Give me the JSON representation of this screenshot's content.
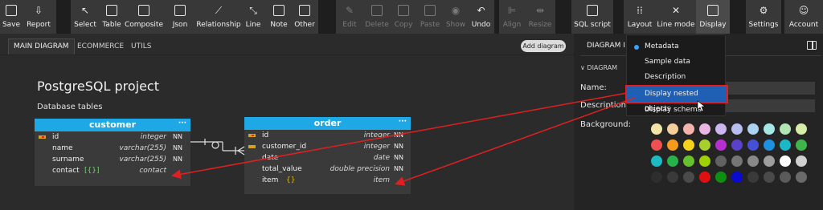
{
  "toolbar": {
    "save": "Save",
    "report": "Report",
    "select": "Select",
    "table": "Table",
    "composite": "Composite",
    "json": "Json",
    "relationship": "Relationship",
    "line": "Line",
    "note": "Note",
    "other": "Other",
    "edit": "Edit",
    "delete": "Delete",
    "copy": "Copy",
    "paste": "Paste",
    "show": "Show",
    "undo": "Undo",
    "align": "Align",
    "resize": "Resize",
    "sql_script": "SQL script",
    "layout": "Layout",
    "line_mode": "Line mode",
    "display": "Display",
    "settings": "Settings",
    "account": "Account"
  },
  "tabs": [
    "MAIN DIAGRAM",
    "ECOMMERCE",
    "UTILS"
  ],
  "add_diagram": "Add diagram",
  "diagram": {
    "title": "PostgreSQL project",
    "subtitle": "Database tables",
    "customer": {
      "name": "customer",
      "menu": "···",
      "rows": [
        {
          "name": "id",
          "type": "integer",
          "nn": "NN"
        },
        {
          "name": "name",
          "type": "varchar(255)",
          "nn": "NN"
        },
        {
          "name": "surname",
          "type": "varchar(255)",
          "nn": "NN"
        },
        {
          "name": "contact",
          "badge": "[{}]",
          "type": "contact",
          "nn": ""
        }
      ]
    },
    "order": {
      "name": "order",
      "menu": "···",
      "rows": [
        {
          "name": "id",
          "type": "integer",
          "nn": "NN"
        },
        {
          "name": "customer_id",
          "type": "integer",
          "nn": "NN"
        },
        {
          "name": "date",
          "type": "date",
          "nn": "NN"
        },
        {
          "name": "total_value",
          "type": "double precision",
          "nn": "NN"
        },
        {
          "name": "item",
          "badge": "{}",
          "type": "item",
          "nn": ""
        }
      ]
    }
  },
  "panel": {
    "tab": "DIAGRAM I",
    "section": "DIAGRAM",
    "name_label": "Name:",
    "description_label": "Description:",
    "background_label": "Background:"
  },
  "display_menu": {
    "items": [
      "Metadata",
      "Sample data",
      "Description",
      "Display nested objects",
      "Display schema"
    ],
    "checked": "Metadata",
    "highlighted": "Display nested objects"
  },
  "colors": {
    "accent": "#1ea8e6",
    "highlight": "#1f5fb4",
    "arrow": "#e02020",
    "swatches": [
      [
        "#f3e4a7",
        "#f4cf9a",
        "#f6b3ad",
        "#e9b5e3",
        "#cbb6ee",
        "#b7bdef",
        "#a9d3f0",
        "#a5e7e5",
        "#b3e4b3",
        "#d7eca7"
      ],
      [
        "#f05050",
        "#f49a1c",
        "#f4d21c",
        "#a8d02c",
        "#b62fcf",
        "#5a41c8",
        "#4550d6",
        "#1e90e0",
        "#1cb8c8",
        "#3fb54a"
      ],
      [
        "#1cbac2",
        "#27b24a",
        "#66c12e",
        "#9fd100",
        "#616161",
        "#757575",
        "#888888",
        "#9e9e9e",
        "#ffffff",
        "#d0d0d0"
      ],
      [
        "#2e2e2e",
        "#3a3a3a",
        "#4a4a4a",
        "#e01010",
        "#0f8f0f",
        "#0a0ad0",
        "#3a3a3a",
        "#4a4a4a",
        "#5a5a5a",
        "#6a6a6a"
      ]
    ]
  }
}
